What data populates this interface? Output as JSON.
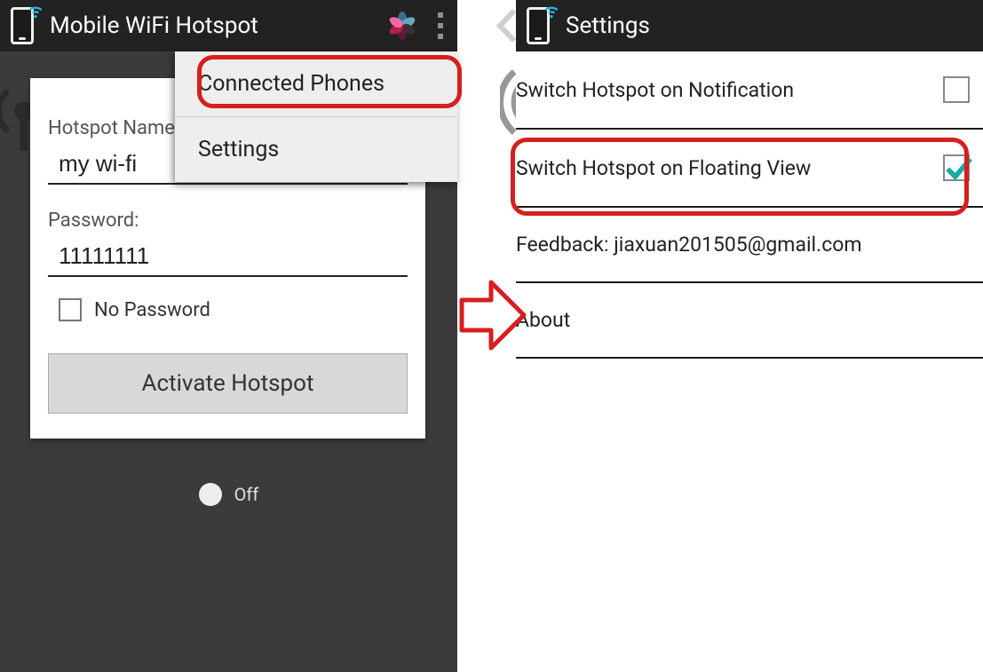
{
  "left": {
    "title": "Mobile WiFi Hotspot",
    "hotspot_name_label": "Hotspot Name:",
    "hotspot_name_value": "my wi-fi",
    "password_label": "Password:",
    "password_value": "11111111",
    "no_password_label": "No Password",
    "activate_button": "Activate Hotspot",
    "toggle_label": "Off",
    "menu": {
      "connected_phones": "Connected Phones",
      "settings": "Settings"
    },
    "flower_colors": [
      "#3b6e8f",
      "#6aa6c4",
      "#333333",
      "#62193f",
      "#b2204a",
      "#f06aa0"
    ]
  },
  "right": {
    "title": "Settings",
    "items": {
      "notification": "Switch Hotspot on Notification",
      "floating": "Switch Hotspot on Floating View",
      "feedback": "Feedback: jiaxuan201505@gmail.com",
      "about": "About"
    },
    "notification_checked": false,
    "floating_checked": true
  }
}
